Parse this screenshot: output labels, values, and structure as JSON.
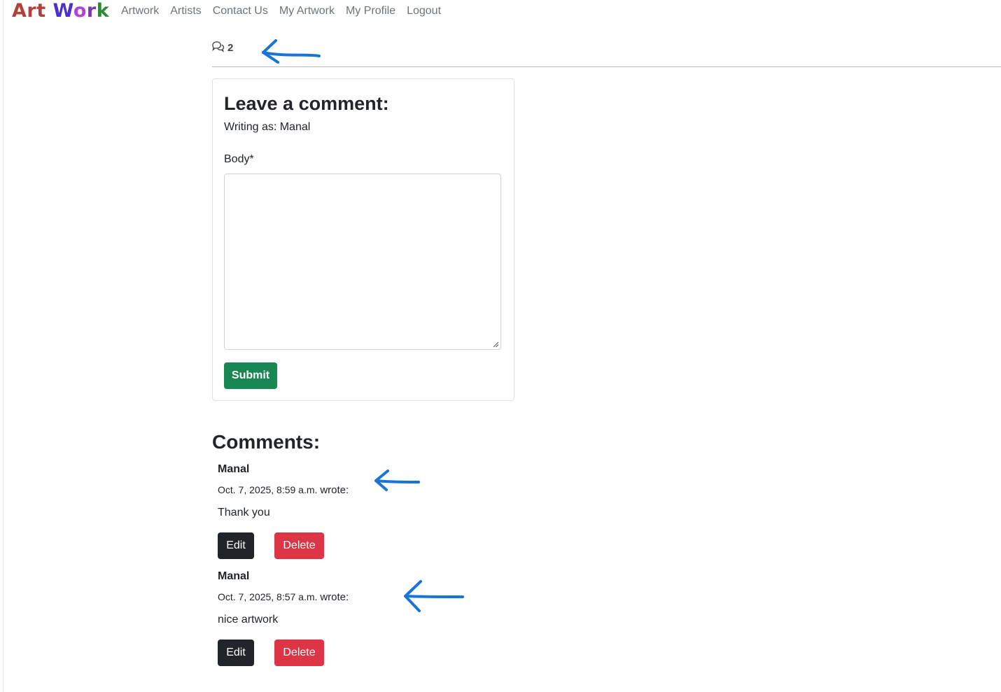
{
  "brand": {
    "part1": "Art",
    "part2": "Work"
  },
  "nav": [
    "Artwork",
    "Artists",
    "Contact Us",
    "My Artwork",
    "My Profile",
    "Logout"
  ],
  "comment_count": "2",
  "form": {
    "heading": "Leave a comment:",
    "writing_as": "Writing as: Manal",
    "body_label": "Body*",
    "body_value": "",
    "submit_label": "Submit"
  },
  "comments_heading": "Comments:",
  "comments": [
    {
      "author": "Manal",
      "date": "Oct. 7, 2025, 8:59 a.m.",
      "wrote": "wrote:",
      "text": "Thank you",
      "edit_label": "Edit",
      "delete_label": "Delete"
    },
    {
      "author": "Manal",
      "date": "Oct. 7, 2025, 8:57 a.m.",
      "wrote": "wrote:",
      "text": "nice artwork",
      "edit_label": "Edit",
      "delete_label": "Delete"
    }
  ],
  "colors": {
    "brand_art": "#b5403a",
    "brand_work_w": "#4b2fd0",
    "brand_work_o": "#b044d4",
    "brand_work_r": "#7c3aa8",
    "brand_work_k": "#2e8a35",
    "submit": "#198754",
    "edit": "#212529",
    "delete": "#dc3545",
    "annotation_arrow": "#1a73d6"
  }
}
